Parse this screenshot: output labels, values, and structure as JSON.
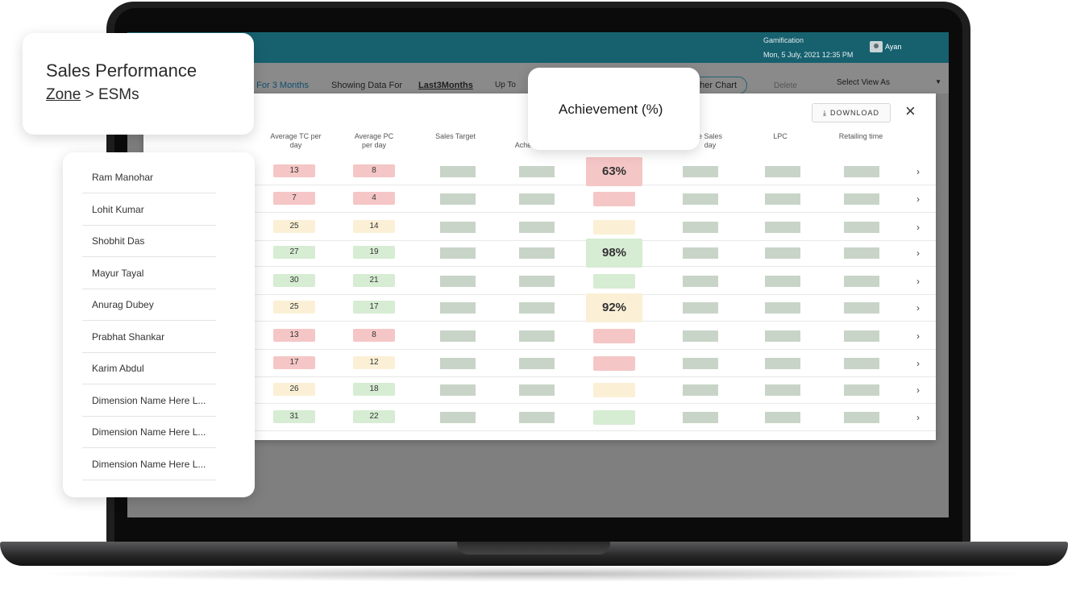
{
  "header": {
    "title": "Gamification",
    "date": "Mon, 5 July, 2021 12:35 PM",
    "user": "Ayan",
    "user_icon": "user-avatar-icon"
  },
  "filters": {
    "period_link": "a For 3 Months",
    "showing_label": "Showing Data For",
    "showing_value": "Last3Months",
    "up_to_label": "Up To",
    "chart_button": "other Chart",
    "delete_label": "Delete",
    "view_select": "Select View As"
  },
  "panel": {
    "download_label": "DOWNLOAD",
    "columns": [
      "Average TC per day",
      "Average PC per day",
      "Sales Target",
      "Ache",
      "e Sales day",
      "LPC",
      "Retailing time"
    ],
    "rows": [
      {
        "tc": "13",
        "tc_status": "red",
        "pc": "8",
        "pc_status": "red",
        "ach": "63%",
        "ach_status": "red"
      },
      {
        "tc": "7",
        "tc_status": "red",
        "pc": "4",
        "pc_status": "red",
        "ach": "",
        "ach_status": "red"
      },
      {
        "tc": "25",
        "tc_status": "yellow",
        "pc": "14",
        "pc_status": "yellow",
        "ach": "",
        "ach_status": "yellow"
      },
      {
        "tc": "27",
        "tc_status": "green",
        "pc": "19",
        "pc_status": "green",
        "ach": "98%",
        "ach_status": "green"
      },
      {
        "tc": "30",
        "tc_status": "green",
        "pc": "21",
        "pc_status": "green",
        "ach": "",
        "ach_status": "green"
      },
      {
        "tc": "25",
        "tc_status": "yellow",
        "pc": "17",
        "pc_status": "green",
        "ach": "92%",
        "ach_status": "yellow"
      },
      {
        "tc": "13",
        "tc_status": "red",
        "pc": "8",
        "pc_status": "red",
        "ach": "",
        "ach_status": "red"
      },
      {
        "tc": "17",
        "tc_status": "red",
        "pc": "12",
        "pc_status": "yellow",
        "ach": "",
        "ach_status": "red"
      },
      {
        "tc": "26",
        "tc_status": "yellow",
        "pc": "18",
        "pc_status": "green",
        "ach": "",
        "ach_status": "yellow"
      },
      {
        "tc": "31",
        "tc_status": "green",
        "pc": "22",
        "pc_status": "green",
        "ach": "",
        "ach_status": "green"
      }
    ]
  },
  "title_card": {
    "title": "Sales Performance",
    "zone": "Zone",
    "path_rest": " > ESMs"
  },
  "achievement_card": {
    "label": "Achievement (%)"
  },
  "names": [
    "Ram Manohar",
    "Lohit Kumar",
    "Shobhit Das",
    "Mayur Tayal",
    "Anurag Dubey",
    "Prabhat Shankar",
    "Karim Abdul",
    "Dimension Name Here L...",
    "Dimension Name Here L...",
    "Dimension Name Here L..."
  ]
}
